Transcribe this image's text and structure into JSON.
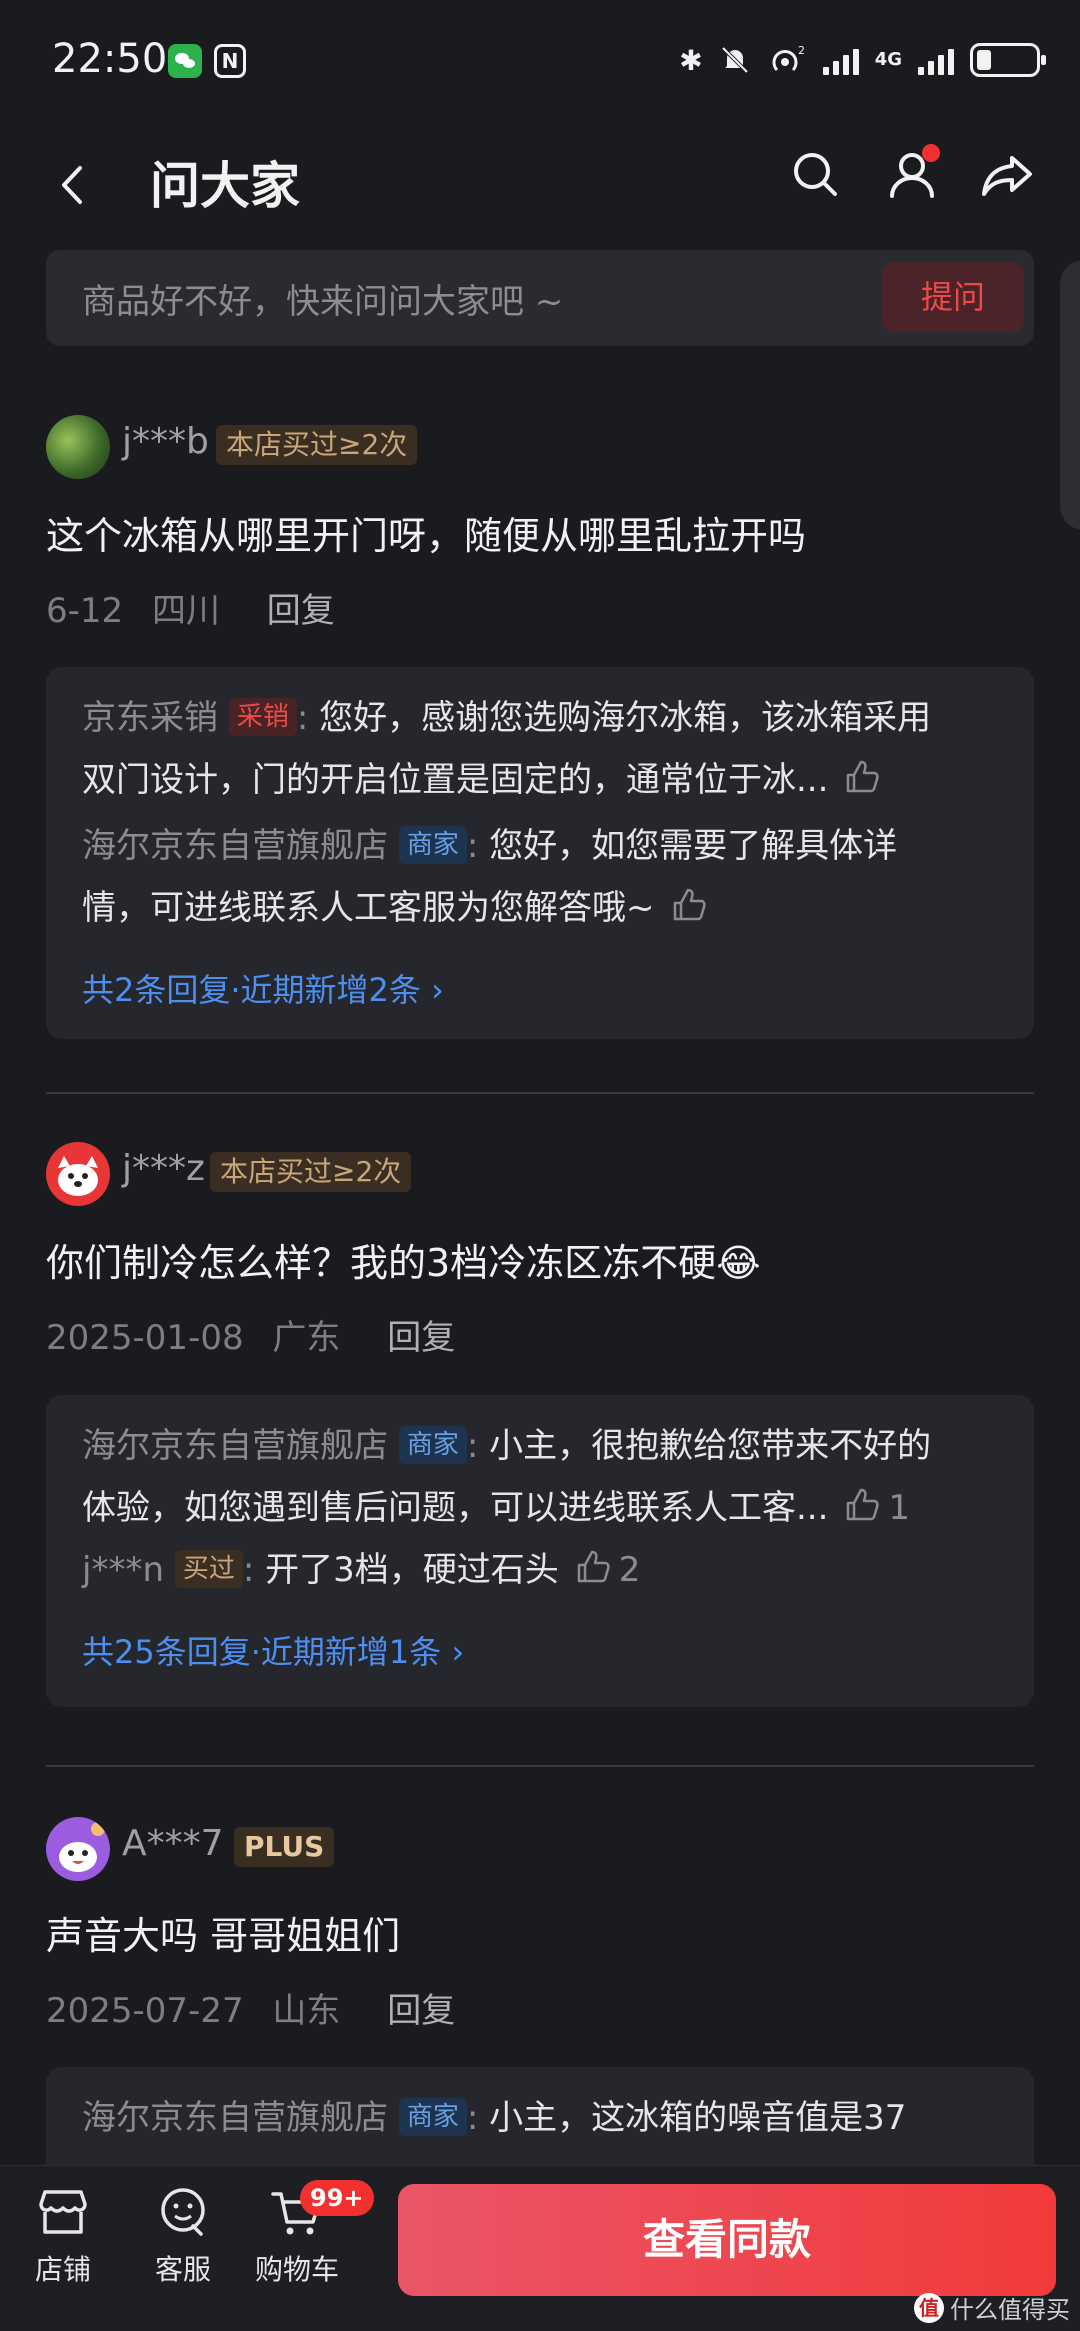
{
  "status": {
    "time": "22:50",
    "network": "4G"
  },
  "header": {
    "title": "问大家"
  },
  "search": {
    "placeholder": "商品好不好，快来问问大家吧 ~",
    "ask_label": "提问"
  },
  "questions": [
    {
      "user": "j***b",
      "tag": "本店买过≥2次",
      "question": "这个冰箱从哪里开门呀，随便从哪里乱拉开吗",
      "date": "6-12",
      "region": "四川",
      "reply_label": "回复",
      "answers": [
        {
          "who": "京东采销",
          "badge": "采销",
          "text_l1": "您好，感谢您选购海尔冰箱，该冰箱采用",
          "text_l2": "双门设计，门的开启位置是固定的，通常位于冰...",
          "likes": ""
        },
        {
          "who": "海尔京东自营旗舰店",
          "badge": "商家",
          "text_l1": "您好，如您需要了解具体详",
          "text_l2": "情，可进线联系人工客服为您解答哦~",
          "likes": ""
        }
      ],
      "more": "共2条回复·近期新增2条"
    },
    {
      "user": "j***z",
      "tag": "本店买过≥2次",
      "question": "你们制冷怎么样？我的3档冷冻区冻不硬😂",
      "date": "2025-01-08",
      "region": "广东",
      "reply_label": "回复",
      "answers": [
        {
          "who": "海尔京东自营旗舰店",
          "badge": "商家",
          "text_l1": "小主，很抱歉给您带来不好的",
          "text_l2": "体验，如您遇到售后问题，可以进线联系人工客...",
          "likes": "1"
        },
        {
          "who": "j***n",
          "badge": "买过",
          "text_l1": "开了3档，硬过石头",
          "likes": "2"
        }
      ],
      "more": "共25条回复·近期新增1条"
    },
    {
      "user": "A***7",
      "tag": "PLUS",
      "question": "声音大吗 哥哥姐姐们",
      "date": "2025-07-27",
      "region": "山东",
      "reply_label": "回复",
      "answers": [
        {
          "who": "海尔京东自营旗舰店",
          "badge": "商家",
          "text_l1": "小主，这冰箱的噪音值是37"
        }
      ]
    }
  ],
  "bottom_bar": {
    "store_label": "店铺",
    "service_label": "客服",
    "cart_label": "购物车",
    "cart_badge": "99+",
    "cta_label": "查看同款"
  },
  "watermark": {
    "logo": "值",
    "text": "什么值得买"
  },
  "colors": {
    "accent_red": "#f23030",
    "link_blue": "#4d8ff0",
    "background": "#1a1b1f"
  }
}
